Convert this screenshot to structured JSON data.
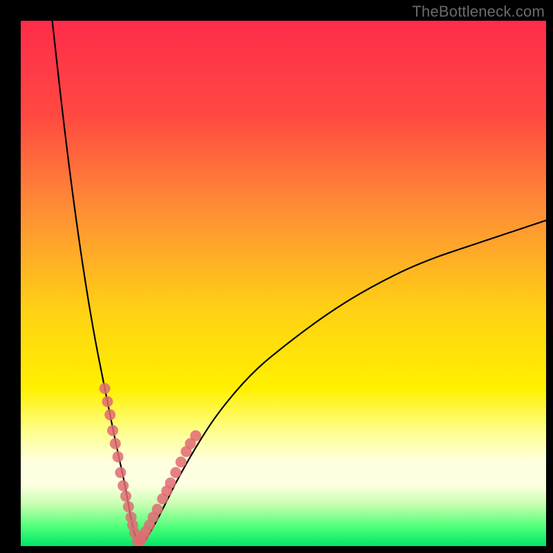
{
  "watermark": "TheBottleneck.com",
  "colors": {
    "frame": "#000000",
    "watermark": "#6b6b6b",
    "curve": "#000000",
    "dots": "#e06b73",
    "gradient_stops": [
      {
        "offset": 0.0,
        "color": "#ff2c4b"
      },
      {
        "offset": 0.18,
        "color": "#ff4941"
      },
      {
        "offset": 0.36,
        "color": "#ff8e36"
      },
      {
        "offset": 0.55,
        "color": "#ffd114"
      },
      {
        "offset": 0.7,
        "color": "#fff000"
      },
      {
        "offset": 0.78,
        "color": "#fdff8a"
      },
      {
        "offset": 0.84,
        "color": "#ffffe0"
      },
      {
        "offset": 0.885,
        "color": "#fbffe0"
      },
      {
        "offset": 0.92,
        "color": "#c8ffb0"
      },
      {
        "offset": 0.965,
        "color": "#4aff77"
      },
      {
        "offset": 1.0,
        "color": "#00e667"
      }
    ]
  },
  "chart_data": {
    "type": "line",
    "title": "",
    "xlabel": "",
    "ylabel": "",
    "xlim": [
      0,
      100
    ],
    "ylim": [
      0,
      100
    ],
    "curve_note": "V-shaped bottleneck curve; y approximates bottleneck percentage vs normalized component score x. Minimum near x≈22 where y≈0. Left branch rises steeply toward 100 at x≈6; right branch rises slowly toward ~62 at x=100.",
    "series": [
      {
        "name": "bottleneck-curve",
        "x": [
          6,
          8,
          10,
          12,
          14,
          16,
          18,
          20,
          21,
          22,
          23,
          24,
          26,
          28,
          30,
          34,
          38,
          44,
          50,
          58,
          66,
          76,
          88,
          100
        ],
        "y": [
          100,
          82,
          66,
          52,
          40,
          30,
          20,
          11,
          5,
          1,
          0.5,
          1.5,
          5,
          9,
          13,
          20,
          26,
          33,
          38,
          44,
          49,
          54,
          58,
          62
        ]
      }
    ],
    "highlight_dots_note": "Pink dots clustered on both branches, roughly between y=2 and y=32.",
    "highlight_dots": [
      {
        "x": 16.0,
        "y": 30.0
      },
      {
        "x": 16.5,
        "y": 27.5
      },
      {
        "x": 17.0,
        "y": 25.0
      },
      {
        "x": 17.5,
        "y": 22.0
      },
      {
        "x": 18.0,
        "y": 19.5
      },
      {
        "x": 18.5,
        "y": 17.0
      },
      {
        "x": 19.0,
        "y": 14.0
      },
      {
        "x": 19.5,
        "y": 11.5
      },
      {
        "x": 20.0,
        "y": 9.5
      },
      {
        "x": 20.5,
        "y": 7.5
      },
      {
        "x": 21.0,
        "y": 5.5
      },
      {
        "x": 21.3,
        "y": 4.0
      },
      {
        "x": 21.7,
        "y": 2.5
      },
      {
        "x": 22.2,
        "y": 1.0
      },
      {
        "x": 22.8,
        "y": 1.0
      },
      {
        "x": 23.3,
        "y": 1.8
      },
      {
        "x": 23.8,
        "y": 2.8
      },
      {
        "x": 24.5,
        "y": 4.0
      },
      {
        "x": 25.2,
        "y": 5.5
      },
      {
        "x": 26.0,
        "y": 7.0
      },
      {
        "x": 27.0,
        "y": 9.0
      },
      {
        "x": 27.8,
        "y": 10.5
      },
      {
        "x": 28.5,
        "y": 12.0
      },
      {
        "x": 29.5,
        "y": 14.0
      },
      {
        "x": 30.5,
        "y": 16.0
      },
      {
        "x": 31.5,
        "y": 18.0
      },
      {
        "x": 32.3,
        "y": 19.5
      },
      {
        "x": 33.3,
        "y": 21.0
      }
    ]
  }
}
